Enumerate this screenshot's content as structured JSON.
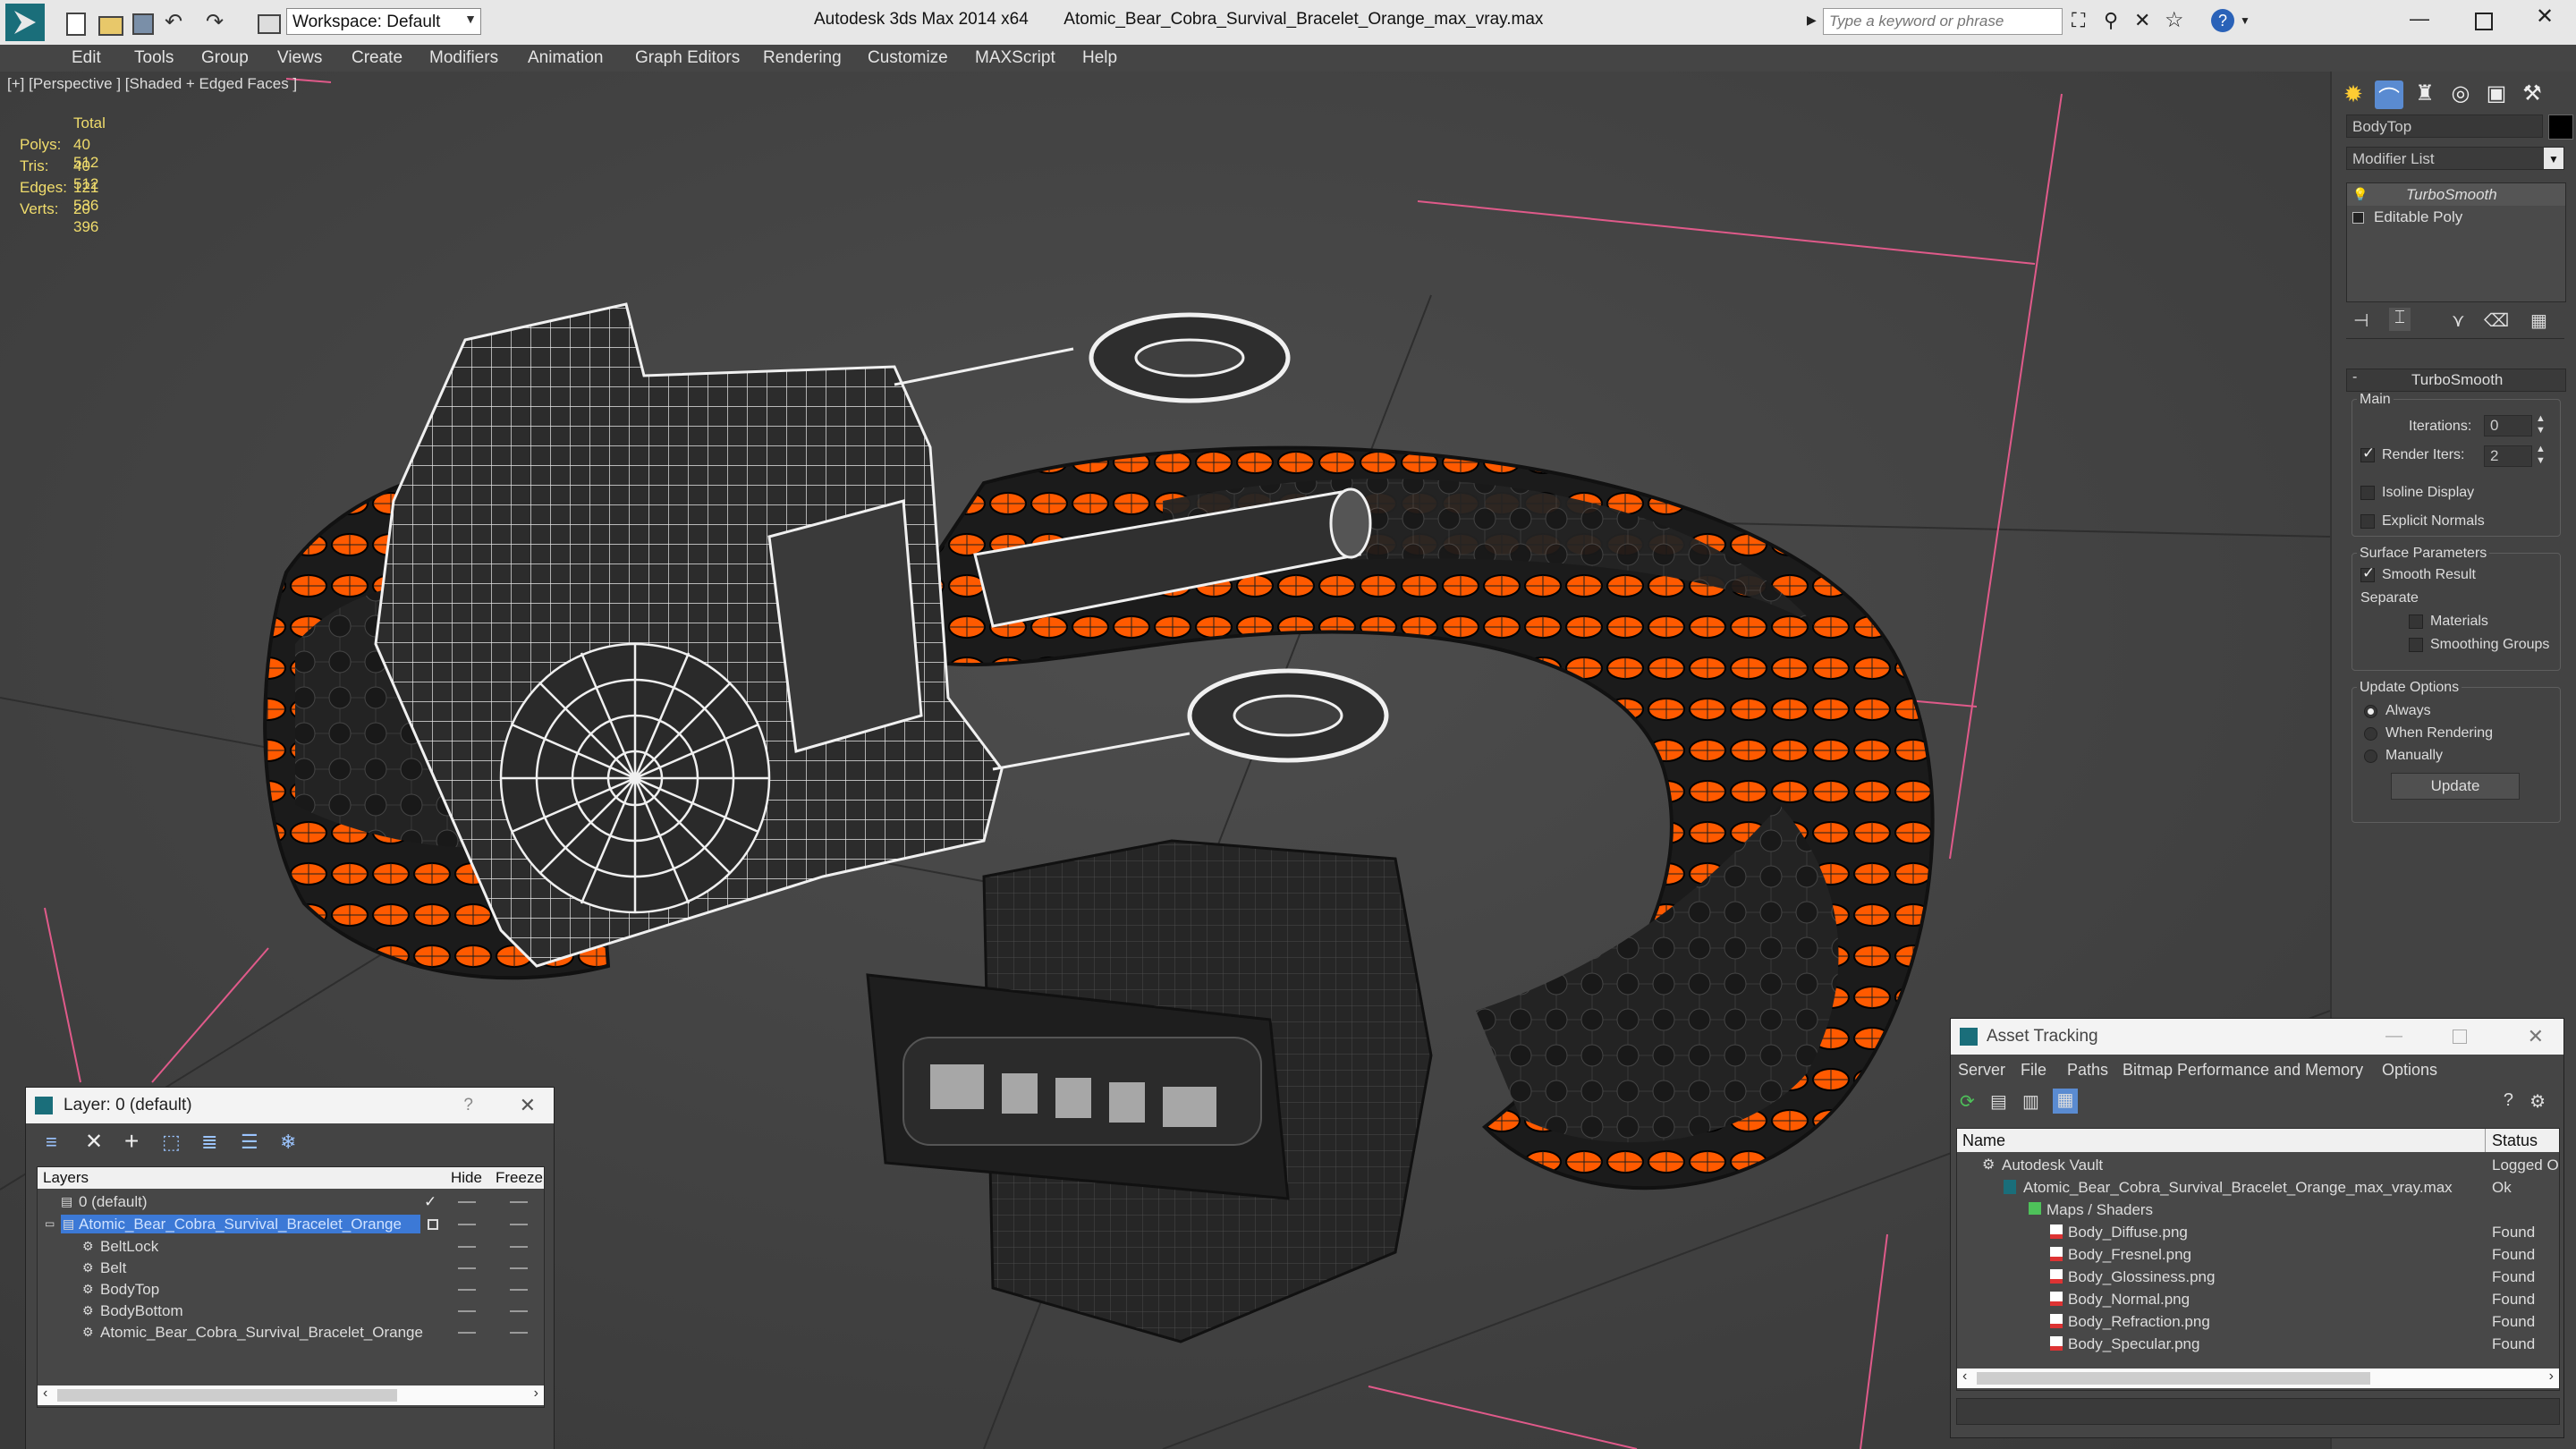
{
  "app": {
    "workspace": "Workspace: Default",
    "title": "Autodesk 3ds Max 2014 x64",
    "filename": "Atomic_Bear_Cobra_Survival_Bracelet_Orange_max_vray.max",
    "search_placeholder": "Type a keyword or phrase"
  },
  "menu": [
    "Edit",
    "Tools",
    "Group",
    "Views",
    "Create",
    "Modifiers",
    "Animation",
    "Graph Editors",
    "Rendering",
    "Customize",
    "MAXScript",
    "Help"
  ],
  "viewport": {
    "label": "[+] [Perspective ] [Shaded + Edged Faces ]",
    "stats_header": "Total",
    "stats": [
      {
        "label": "Polys:",
        "value": "40 512"
      },
      {
        "label": "Tris:",
        "value": "40 512"
      },
      {
        "label": "Edges:",
        "value": "121 536"
      },
      {
        "label": "Verts:",
        "value": "20 396"
      }
    ]
  },
  "command_panel": {
    "object_name": "BodyTop",
    "modifier_list": "Modifier List",
    "stack": [
      "TurboSmooth",
      "Editable Poly"
    ],
    "rollout_title": "TurboSmooth",
    "main_group": "Main",
    "iterations_label": "Iterations:",
    "iterations_value": "0",
    "render_iters_label": "Render Iters:",
    "render_iters_value": "2",
    "isoline_display": "Isoline Display",
    "explicit_normals": "Explicit Normals",
    "surface_group": "Surface Parameters",
    "smooth_result": "Smooth Result",
    "separate": "Separate",
    "materials": "Materials",
    "smoothing_groups": "Smoothing Groups",
    "update_group": "Update Options",
    "always": "Always",
    "when_rendering": "When Rendering",
    "manually": "Manually",
    "update_button": "Update"
  },
  "layer_dialog": {
    "title": "Layer: 0 (default)",
    "help": "?",
    "col_layers": "Layers",
    "col_hide": "Hide",
    "col_freeze": "Freeze",
    "rows": [
      {
        "name": "0 (default)",
        "indent": 0,
        "selected": false
      },
      {
        "name": "Atomic_Bear_Cobra_Survival_Bracelet_Orange",
        "indent": 0,
        "selected": true
      },
      {
        "name": "BeltLock",
        "indent": 1,
        "selected": false
      },
      {
        "name": "Belt",
        "indent": 1,
        "selected": false
      },
      {
        "name": "BodyTop",
        "indent": 1,
        "selected": false
      },
      {
        "name": "BodyBottom",
        "indent": 1,
        "selected": false
      },
      {
        "name": "Atomic_Bear_Cobra_Survival_Bracelet_Orange",
        "indent": 1,
        "selected": false
      }
    ]
  },
  "asset_tracking": {
    "title": "Asset Tracking",
    "menu": [
      "Server",
      "File",
      "Paths",
      "Bitmap Performance and Memory",
      "Options"
    ],
    "col_name": "Name",
    "col_status": "Status",
    "rows": [
      {
        "name": "Autodesk Vault",
        "status": "Logged O",
        "indent": 0
      },
      {
        "name": "Atomic_Bear_Cobra_Survival_Bracelet_Orange_max_vray.max",
        "status": "Ok",
        "indent": 1
      },
      {
        "name": "Maps / Shaders",
        "status": "",
        "indent": 2
      },
      {
        "name": "Body_Diffuse.png",
        "status": "Found",
        "indent": 3
      },
      {
        "name": "Body_Fresnel.png",
        "status": "Found",
        "indent": 3
      },
      {
        "name": "Body_Glossiness.png",
        "status": "Found",
        "indent": 3
      },
      {
        "name": "Body_Normal.png",
        "status": "Found",
        "indent": 3
      },
      {
        "name": "Body_Refraction.png",
        "status": "Found",
        "indent": 3
      },
      {
        "name": "Body_Specular.png",
        "status": "Found",
        "indent": 3
      }
    ]
  },
  "colors": {
    "orange": "#ff5a00",
    "selection": "#3c79d6",
    "stats_yellow": "#f0dc6c"
  }
}
